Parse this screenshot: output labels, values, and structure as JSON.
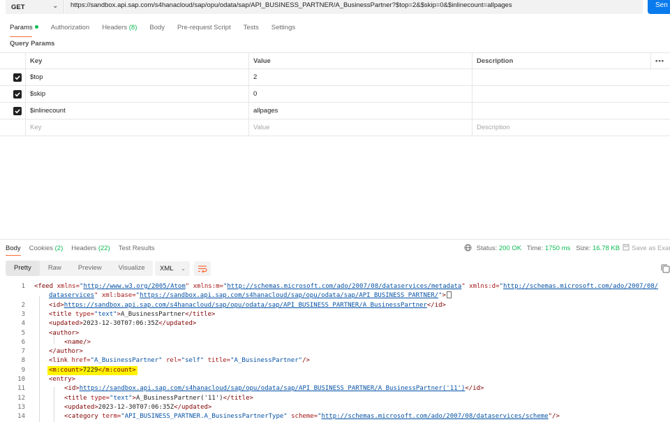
{
  "request": {
    "method": "GET",
    "url": "https://sandbox.api.sap.com/s4hanacloud/sap/opu/odata/sap/API_BUSINESS_PARTNER/A_BusinessPartner?$top=2&$skip=0&$inlinecount=allpages",
    "send_label": "Sen"
  },
  "request_tabs": {
    "params": "Params",
    "authorization": "Authorization",
    "headers": "Headers",
    "headers_count": "(8)",
    "body": "Body",
    "prerequest": "Pre-request Script",
    "tests": "Tests",
    "settings": "Settings"
  },
  "query_params": {
    "label": "Query Params",
    "columns": {
      "key": "Key",
      "value": "Value",
      "description": "Description"
    },
    "rows": [
      {
        "key": "$top",
        "value": "2",
        "checked": true
      },
      {
        "key": "$skip",
        "value": "0",
        "checked": true
      },
      {
        "key": "$inlinecount",
        "value": "allpages",
        "checked": true
      }
    ],
    "placeholder": {
      "key": "Key",
      "value": "Value",
      "description": "Description"
    },
    "more_label": "•••"
  },
  "response_tabs": {
    "body": "Body",
    "cookies": "Cookies",
    "cookies_count": "(2)",
    "headers": "Headers",
    "headers_count": "(22)",
    "test_results": "Test Results"
  },
  "response_status": {
    "status_label": "Status:",
    "status_value": "200 OK",
    "time_label": "Time:",
    "time_value": "1750 ms",
    "size_label": "Size:",
    "size_value": "16.78 KB",
    "save_label": "Save as Exam"
  },
  "view": {
    "modes": [
      "Pretty",
      "Raw",
      "Preview",
      "Visualize"
    ],
    "active": "Pretty",
    "format": "XML"
  },
  "code": {
    "line_numbers": [
      "1",
      "",
      "2",
      "3",
      "4",
      "5",
      "6",
      "7",
      "8",
      "9",
      "10",
      "11",
      "12",
      "13",
      "14"
    ],
    "l1a_tag": "<feed",
    "l1a_attr1": " xmlns=",
    "l1a_val1q": "\"",
    "l1a_val1": "http://www.w3.org/2005/Atom",
    "l1a_attr2": "\" xmlns:m=",
    "l1a_val2": "http://schemas.microsoft.com/ado/2007/08/dataservices/metadata",
    "l1a_attr3": "\" xmlns:d=",
    "l1a_val3": "http://schemas.microsoft.com/ado/2007/08/",
    "l1b_val3": "dataservices",
    "l1b_attr4": "\" xml:base=",
    "l1b_val4": "https://sandbox.api.sap.com/s4hanacloud/sap/opu/odata/sap/API_BUSINESS_PARTNER/",
    "l2_open": "<id>",
    "l2_text": "https://sandbox.api.sap.com/s4hanacloud/sap/opu/odata/sap/API_BUSINESS_PARTNER/A_BusinessPartner",
    "l2_close": "</id>",
    "l3_open": "<title",
    "l3_attr": " type=",
    "l3_val": "\"text\"",
    "l3_gt": ">",
    "l3_text": "A_BusinessPartner",
    "l3_close": "</title>",
    "l4_open": "<updated>",
    "l4_text": "2023-12-30T07:06:35Z",
    "l4_close": "</updated>",
    "l5": "<author>",
    "l6": "<name/>",
    "l7": "</author>",
    "l8_open": "<link",
    "l8_attr1": " href=",
    "l8_val1": "\"A_BusinessPartner\"",
    "l8_attr2": " rel=",
    "l8_val2": "\"self\"",
    "l8_attr3": " title=",
    "l8_val3": "\"A_BusinessPartner\"",
    "l8_end": "/>",
    "l9_open": "<m:count>",
    "l9_text": "7229",
    "l9_close": "</m:count>",
    "l10": "<entry>",
    "l11_open": "<id>",
    "l11_text": "https://sandbox.api.sap.com/s4hanacloud/sap/opu/odata/sap/API_BUSINESS_PARTNER/A_BusinessPartner('11')",
    "l11_close": "</id>",
    "l12_open": "<title",
    "l12_attr": " type=",
    "l12_val": "\"text\"",
    "l12_gt": ">",
    "l12_text": "A_BusinessPartner('11')",
    "l12_close": "</title>",
    "l13_open": "<updated>",
    "l13_text": "2023-12-30T07:06:35Z",
    "l13_close": "</updated>",
    "l14_open": "<category",
    "l14_attr1": " term=",
    "l14_val1": "\"API_BUSINESS_PARTNER.A_BusinessPartnerType\"",
    "l14_attr2": " scheme=",
    "l14_val2": "http://schemas.microsoft.com/ado/2007/08/dataservices/scheme",
    "l14_end": "\"/>"
  }
}
